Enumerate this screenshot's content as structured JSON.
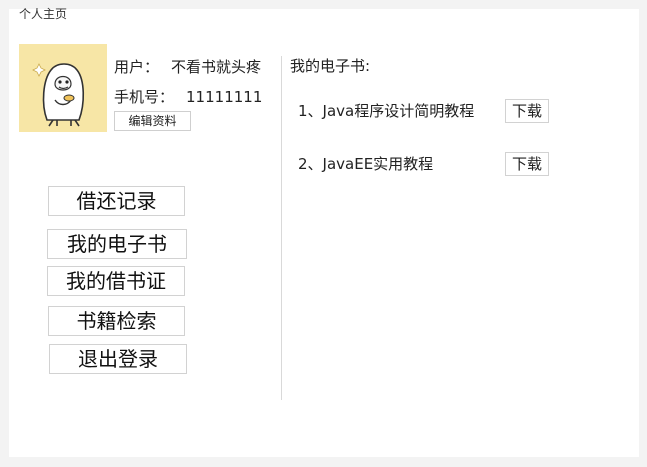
{
  "page": {
    "title": "个人主页"
  },
  "profile": {
    "user_label": "用户：",
    "user_value": "不看书就头疼",
    "phone_label": "手机号：",
    "phone_value": "11111111",
    "edit_label": "编辑资料"
  },
  "nav": {
    "items": [
      {
        "label": "借还记录"
      },
      {
        "label": "我的电子书"
      },
      {
        "label": "我的借书证"
      },
      {
        "label": "书籍检索"
      },
      {
        "label": "退出登录"
      }
    ]
  },
  "ebooks": {
    "title": "我的电子书:",
    "items": [
      {
        "text": "1、Java程序设计简明教程",
        "download_label": "下载"
      },
      {
        "text": "2、JavaEE实用教程",
        "download_label": "下载"
      }
    ]
  },
  "colors": {
    "avatar_bg": "#f7e6a6",
    "panel_bg": "#ffffff",
    "page_bg": "#f3f3f3"
  }
}
